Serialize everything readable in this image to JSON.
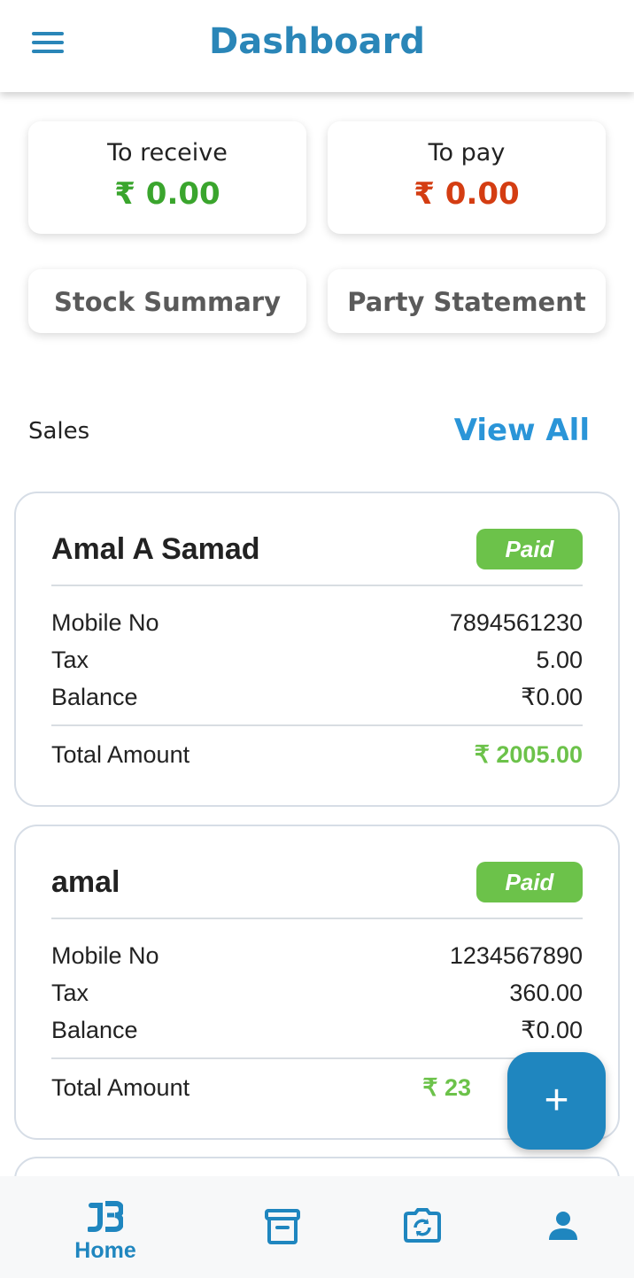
{
  "header": {
    "title": "Dashboard"
  },
  "summary": {
    "receive": {
      "label": "To receive",
      "value": "₹ 0.00",
      "color": "#3aa52d"
    },
    "pay": {
      "label": "To pay",
      "value": "₹ 0.00",
      "color": "#d43d12"
    }
  },
  "buttons": {
    "stock": "Stock Summary",
    "party": "Party Statement"
  },
  "sales": {
    "label": "Sales",
    "view_all": "View All",
    "items": [
      {
        "name": "Amal A Samad",
        "status": "Paid",
        "mobile_label": "Mobile No",
        "mobile": "7894561230",
        "tax_label": "Tax",
        "tax": "5.00",
        "balance_label": "Balance",
        "balance": "₹0.00",
        "total_label": "Total Amount",
        "total": "₹ 2005.00"
      },
      {
        "name": "amal",
        "status": "Paid",
        "mobile_label": "Mobile No",
        "mobile": "1234567890",
        "tax_label": "Tax",
        "tax": "360.00",
        "balance_label": "Balance",
        "balance": "₹0.00",
        "total_label": "Total Amount",
        "total": "₹ 23"
      }
    ]
  },
  "fab": {
    "label": "+"
  },
  "nav": {
    "home": {
      "label": "Home",
      "icon": "app-logo-icon"
    },
    "archive": {
      "icon": "archive-icon"
    },
    "camera": {
      "icon": "camera-rotate-icon"
    },
    "profile": {
      "icon": "person-icon"
    }
  },
  "colors": {
    "primary": "#2a86b8",
    "paid": "#6cc24a"
  }
}
